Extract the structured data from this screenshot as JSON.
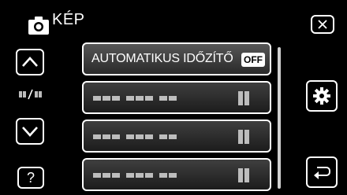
{
  "header": {
    "title": "KÉP",
    "camera_icon": "camera-icon",
    "close_icon": "close-icon"
  },
  "sidebar": {
    "up_icon": "chevron-up-icon",
    "page_indicator_icon": "page-indicator-icon",
    "down_icon": "chevron-down-icon",
    "help_label": "?"
  },
  "menu": {
    "items": [
      {
        "label": "AUTOMATIKUS IDŐZÍTŐ",
        "value": "OFF",
        "selected": true
      },
      {
        "label": "",
        "value": "",
        "selected": false
      },
      {
        "label": "",
        "value": "",
        "selected": false
      },
      {
        "label": "",
        "value": "",
        "selected": false
      }
    ]
  },
  "right_controls": {
    "settings_icon": "gear-icon",
    "back_icon": "return-icon"
  },
  "colors": {
    "background": "#000000",
    "foreground": "#ffffff",
    "item_fill": "#2f2f2f",
    "placeholder": "#bdbdbd"
  }
}
